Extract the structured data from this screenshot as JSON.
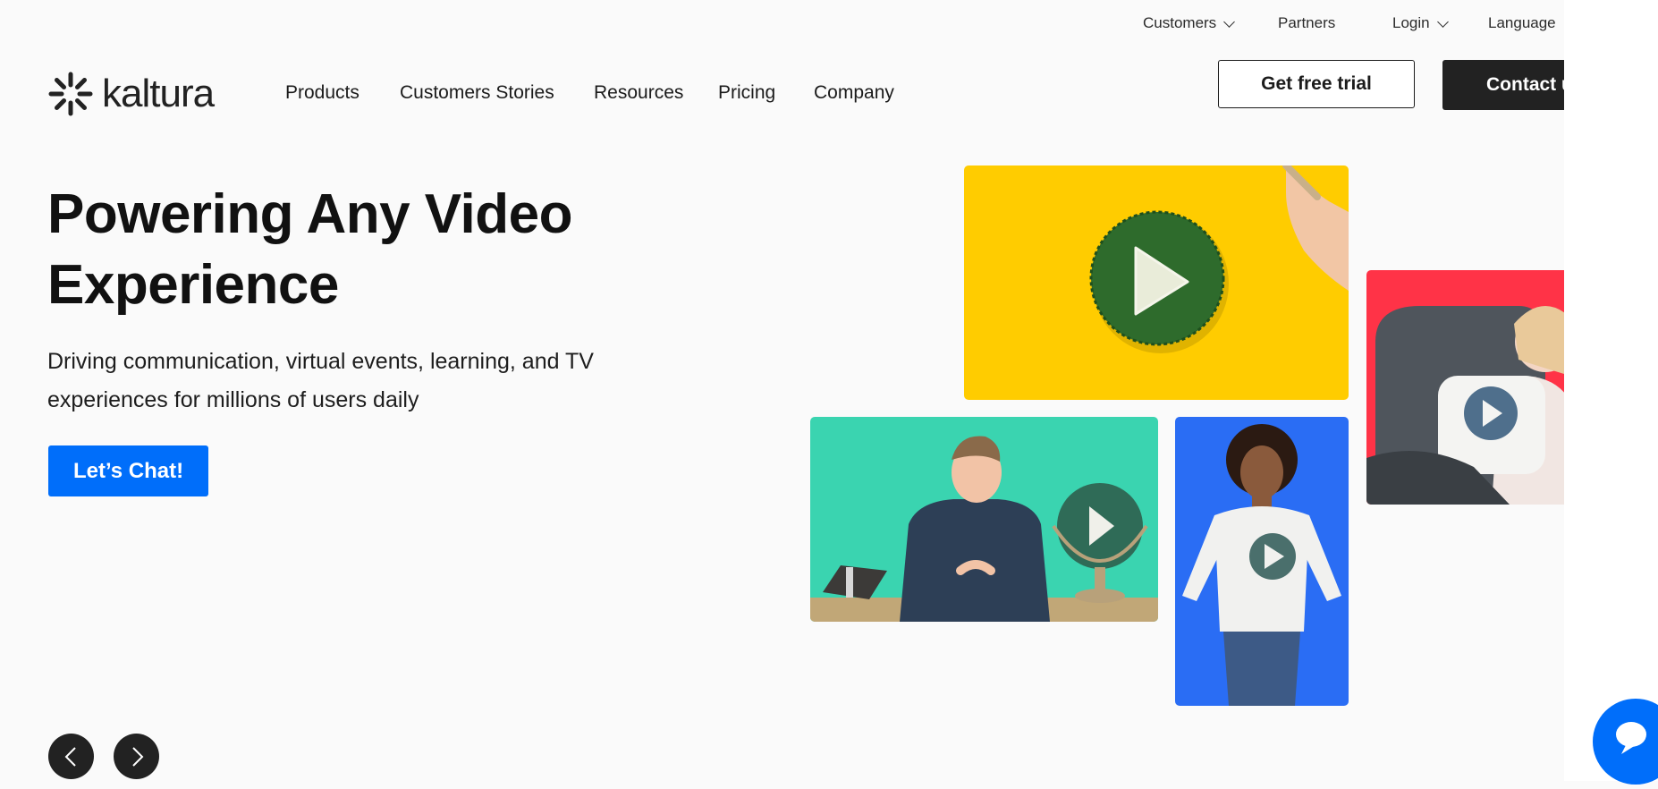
{
  "utility_nav": {
    "customers": "Customers",
    "partners": "Partners",
    "login": "Login",
    "language": "Language"
  },
  "logo": {
    "text": "kaltura",
    "icon": "kaltura-burst-logo-icon"
  },
  "main_nav": {
    "items": [
      "Products",
      "Customers Stories",
      "Resources",
      "Pricing",
      "Company"
    ]
  },
  "cta": {
    "trial": "Get free trial",
    "contact": "Contact u"
  },
  "hero": {
    "title_line1": "Powering Any Video",
    "title_line2": "Experience",
    "subtitle_line1": "Driving communication, virtual events, learning, and TV",
    "subtitle_line2": "experiences for millions of users daily",
    "chat_button": "Let’s Chat!"
  },
  "media_tiles": [
    {
      "name": "yellow-play-tile",
      "color": "#ffcc00",
      "icon": "play-icon"
    },
    {
      "name": "red-pillow-tile",
      "color": "#ff3347",
      "icon": "play-icon"
    },
    {
      "name": "green-presenter-tile",
      "color": "#3ad4b0",
      "icon": "play-icon"
    },
    {
      "name": "blue-woman-tile",
      "color": "#2a6df4",
      "icon": "play-icon"
    }
  ],
  "carousel": {
    "prev_icon": "chevron-left-icon",
    "next_icon": "chevron-right-icon"
  },
  "chat_widget": {
    "icon": "chat-bubble-icon"
  },
  "colors": {
    "accent": "#006efa",
    "dark": "#222222",
    "background": "#fafafa"
  }
}
